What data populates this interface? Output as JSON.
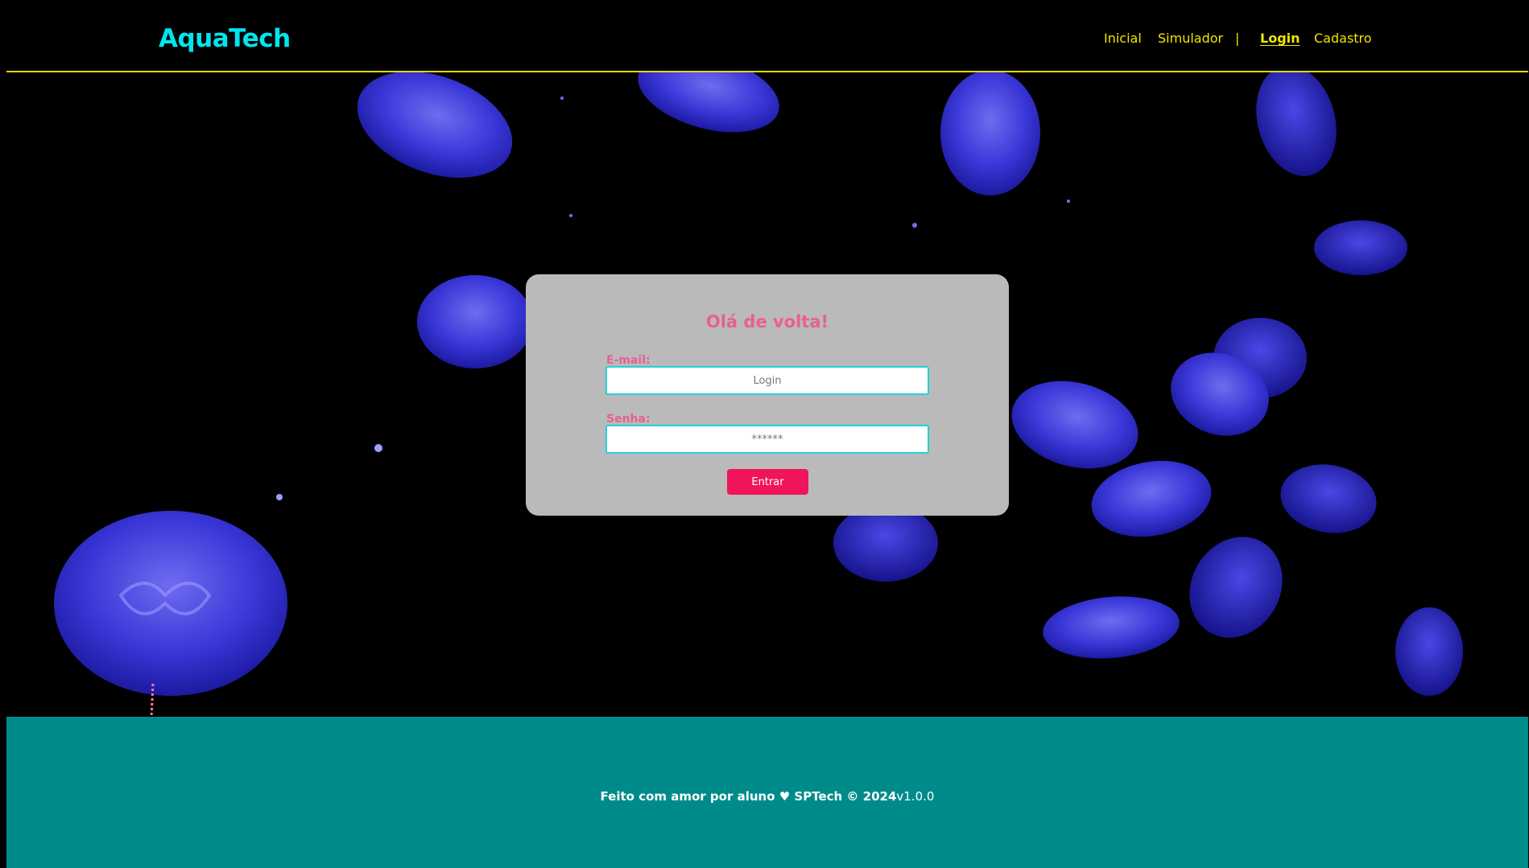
{
  "header": {
    "brand": "AquaTech",
    "nav": {
      "inicial": "Inicial",
      "simulador": "Simulador",
      "separator": "|",
      "login": "Login",
      "cadastro": "Cadastro"
    }
  },
  "login_card": {
    "title": "Olá de volta!",
    "email_label": "E-mail:",
    "email_placeholder": "Login",
    "email_value": "",
    "password_label": "Senha:",
    "password_placeholder": "******",
    "password_value": "",
    "submit_label": "Entrar"
  },
  "footer": {
    "credit": "Feito com amor por aluno ♥ SPTech © 2024",
    "version": "v1.0.0"
  },
  "colors": {
    "brand": "#00e5ee",
    "nav": "#f2e600",
    "card": "#bababa",
    "accent_pink": "#e8608f",
    "button": "#f0155a",
    "footer": "#008b8b"
  }
}
